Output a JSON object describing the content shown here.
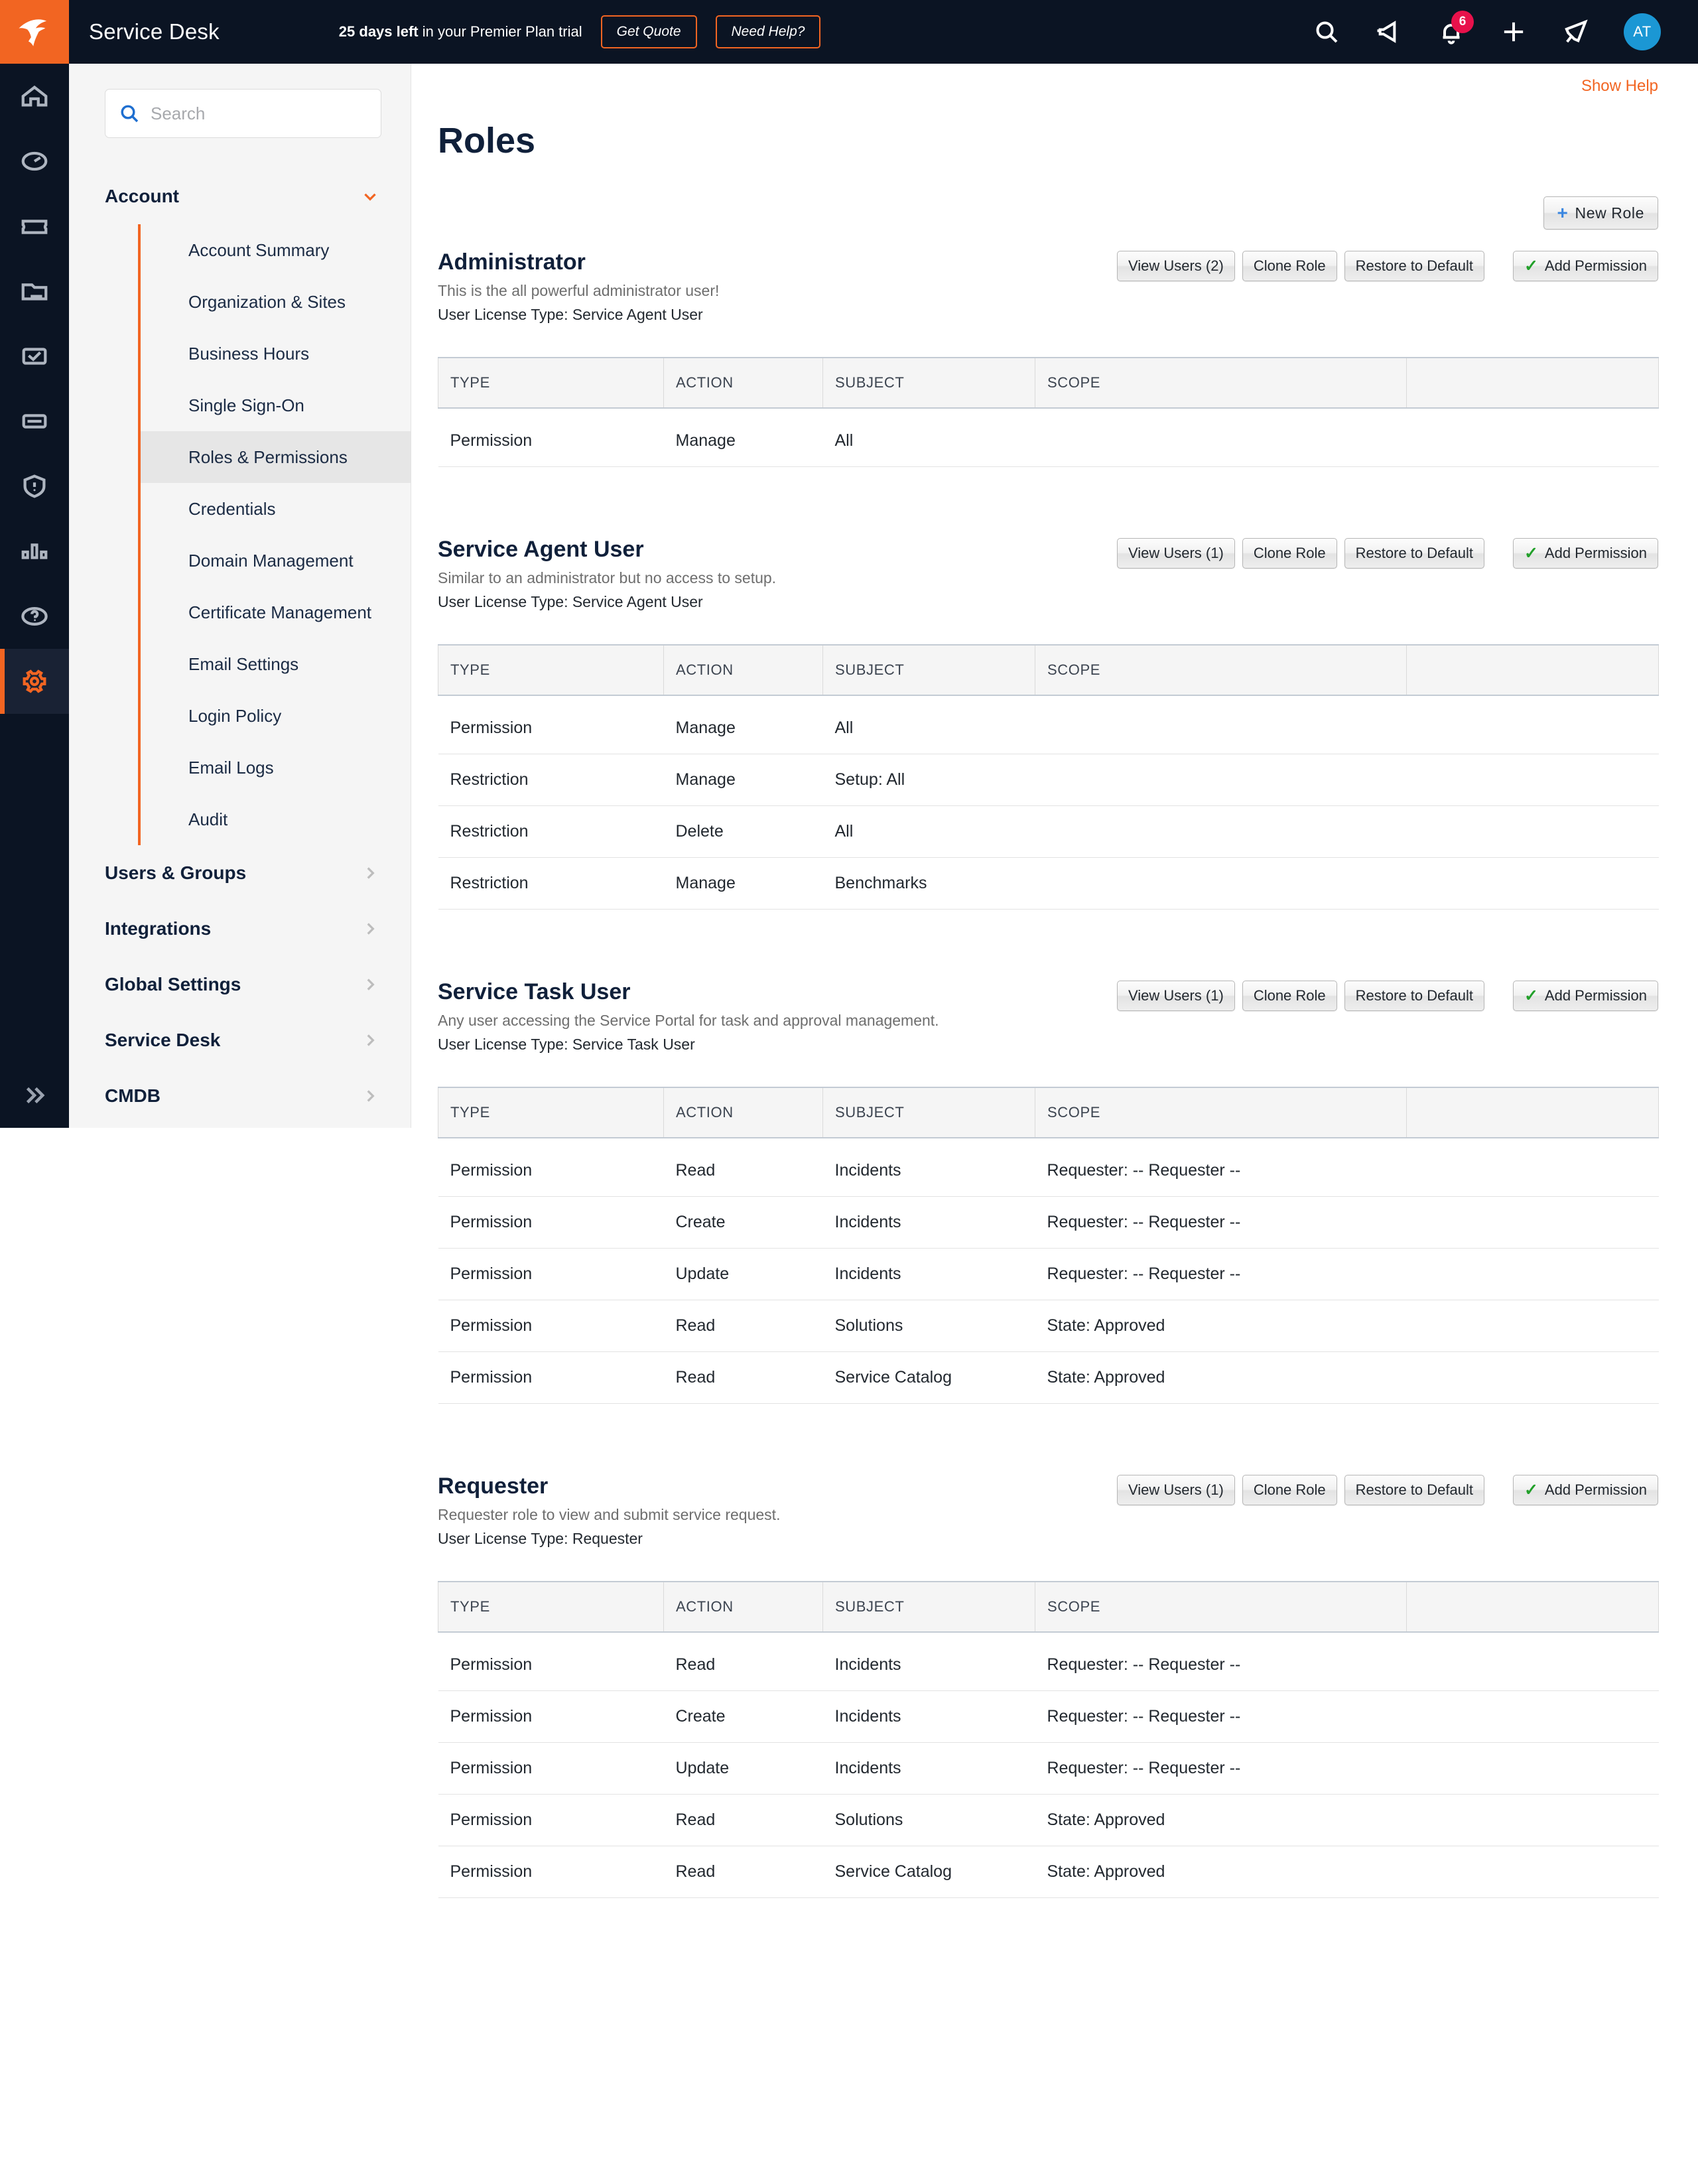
{
  "topbar": {
    "logo_icon": "solarwinds-logo",
    "app_title": "Service Desk",
    "trial_bold": "25 days left",
    "trial_rest": " in your Premier Plan trial",
    "get_quote_label": "Get Quote",
    "need_help_label": "Need Help?",
    "icons": [
      {
        "name": "search-icon"
      },
      {
        "name": "announcement-icon"
      },
      {
        "name": "notification-bell-icon",
        "badge": "6"
      },
      {
        "name": "add-icon"
      },
      {
        "name": "launch-rocket-icon"
      }
    ],
    "avatar_initials": "AT",
    "avatar_color": "#1b97d4"
  },
  "rail": {
    "items": [
      {
        "name": "home-icon",
        "active": false
      },
      {
        "name": "dashboard-gauge-icon",
        "active": false
      },
      {
        "name": "ticket-icon",
        "active": false
      },
      {
        "name": "assets-folder-icon",
        "active": false
      },
      {
        "name": "tasks-checkbox-icon",
        "active": false
      },
      {
        "name": "purchasing-card-icon",
        "active": false
      },
      {
        "name": "risk-shield-icon",
        "active": false
      },
      {
        "name": "reports-bar-chart-icon",
        "active": false
      },
      {
        "name": "knowledge-help-icon",
        "active": false
      },
      {
        "name": "setup-gear-icon",
        "active": true
      }
    ],
    "expand_icon": "expand-chevrons-icon"
  },
  "nav": {
    "search": {
      "value": "",
      "placeholder": "Search",
      "icon": "search-icon"
    },
    "groups": [
      {
        "label": "Account",
        "expanded": true,
        "chevron": "chevron-down-icon",
        "items": [
          {
            "label": "Account Summary",
            "active": false
          },
          {
            "label": "Organization & Sites",
            "active": false
          },
          {
            "label": "Business Hours",
            "active": false
          },
          {
            "label": "Single Sign-On",
            "active": false
          },
          {
            "label": "Roles & Permissions",
            "active": true
          },
          {
            "label": "Credentials",
            "active": false
          },
          {
            "label": "Domain Management",
            "active": false
          },
          {
            "label": "Certificate Management",
            "active": false
          },
          {
            "label": "Email Settings",
            "active": false
          },
          {
            "label": "Login Policy",
            "active": false
          },
          {
            "label": "Email Logs",
            "active": false
          },
          {
            "label": "Audit",
            "active": false
          }
        ]
      },
      {
        "label": "Users & Groups",
        "expanded": false,
        "chevron": "chevron-right-icon",
        "items": []
      },
      {
        "label": "Integrations",
        "expanded": false,
        "chevron": "chevron-right-icon",
        "items": []
      },
      {
        "label": "Global Settings",
        "expanded": false,
        "chevron": "chevron-right-icon",
        "items": []
      },
      {
        "label": "Service Desk",
        "expanded": false,
        "chevron": "chevron-right-icon",
        "items": []
      },
      {
        "label": "CMDB",
        "expanded": false,
        "chevron": "chevron-right-icon",
        "items": []
      }
    ]
  },
  "main": {
    "show_help_label": "Show Help",
    "page_title": "Roles",
    "new_role_label": "New Role",
    "new_role_icon": "plus-icon",
    "columns": [
      "TYPE",
      "ACTION",
      "SUBJECT",
      "SCOPE",
      ""
    ],
    "action_labels": {
      "clone": "Clone Role",
      "restore": "Restore to Default",
      "add_permission": "Add Permission",
      "add_permission_icon": "check-icon"
    },
    "roles": [
      {
        "name": "Administrator",
        "description": "This is the all powerful administrator user!",
        "license": "User License Type: Service Agent User",
        "view_users_label": "View Users (2)",
        "rows": [
          {
            "type": "Permission",
            "kind": "perm",
            "action": "Manage",
            "subject": "All",
            "scope": ""
          }
        ]
      },
      {
        "name": "Service Agent User",
        "description": "Similar to an administrator but no access to setup.",
        "license": "User License Type: Service Agent User",
        "view_users_label": "View Users (1)",
        "rows": [
          {
            "type": "Permission",
            "kind": "perm",
            "action": "Manage",
            "subject": "All",
            "scope": ""
          },
          {
            "type": "Restriction",
            "kind": "restr",
            "action": "Manage",
            "subject": "Setup: All",
            "scope": ""
          },
          {
            "type": "Restriction",
            "kind": "restr",
            "action": "Delete",
            "subject": "All",
            "scope": ""
          },
          {
            "type": "Restriction",
            "kind": "restr",
            "action": "Manage",
            "subject": "Benchmarks",
            "scope": ""
          }
        ]
      },
      {
        "name": "Service Task User",
        "description": "Any user accessing the Service Portal for task and approval management.",
        "license": "User License Type: Service Task User",
        "view_users_label": "View Users (1)",
        "rows": [
          {
            "type": "Permission",
            "kind": "perm",
            "action": "Read",
            "subject": "Incidents",
            "scope": "Requester: -- Requester --"
          },
          {
            "type": "Permission",
            "kind": "perm",
            "action": "Create",
            "subject": "Incidents",
            "scope": "Requester: -- Requester --"
          },
          {
            "type": "Permission",
            "kind": "perm",
            "action": "Update",
            "subject": "Incidents",
            "scope": "Requester: -- Requester --"
          },
          {
            "type": "Permission",
            "kind": "perm",
            "action": "Read",
            "subject": "Solutions",
            "scope": "State: Approved"
          },
          {
            "type": "Permission",
            "kind": "perm",
            "action": "Read",
            "subject": "Service Catalog",
            "scope": "State: Approved"
          }
        ]
      },
      {
        "name": "Requester",
        "description": "Requester role to view and submit service request.",
        "license": "User License Type: Requester",
        "view_users_label": "View Users (1)",
        "rows": [
          {
            "type": "Permission",
            "kind": "perm",
            "action": "Read",
            "subject": "Incidents",
            "scope": "Requester: -- Requester --"
          },
          {
            "type": "Permission",
            "kind": "perm",
            "action": "Create",
            "subject": "Incidents",
            "scope": "Requester: -- Requester --"
          },
          {
            "type": "Permission",
            "kind": "perm",
            "action": "Update",
            "subject": "Incidents",
            "scope": "Requester: -- Requester --"
          },
          {
            "type": "Permission",
            "kind": "perm",
            "action": "Read",
            "subject": "Solutions",
            "scope": "State: Approved"
          },
          {
            "type": "Permission",
            "kind": "perm",
            "action": "Read",
            "subject": "Service Catalog",
            "scope": "State: Approved"
          }
        ]
      }
    ]
  }
}
